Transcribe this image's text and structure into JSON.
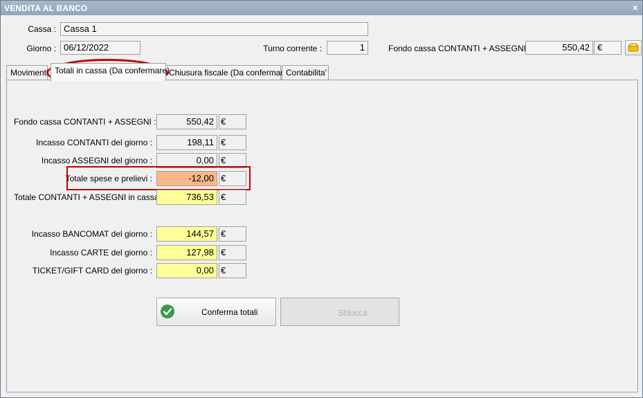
{
  "window": {
    "title": "VENDITA AL BANCO",
    "close_glyph": "×"
  },
  "header": {
    "cassa_label": "Cassa :",
    "cassa_value": "Cassa 1",
    "giorno_label": "Giorno :",
    "giorno_value": "06/12/2022",
    "turno_label": "Turno corrente :",
    "turno_value": "1",
    "fondo_label": "Fondo cassa CONTANTI + ASSEGNI :",
    "fondo_value": "550,42",
    "fondo_currency": "€"
  },
  "tabs": [
    {
      "label": "Movimenti"
    },
    {
      "label": "Totali in cassa (Da confermare)",
      "active": true
    },
    {
      "label": "Chiusura fiscale (Da confermare)"
    },
    {
      "label": "Contabilita'"
    }
  ],
  "totals": {
    "rows": [
      {
        "label": "Fondo cassa CONTANTI + ASSEGNI :",
        "value": "550,42",
        "currency": "€"
      },
      {
        "label": "Incasso CONTANTI del giorno :",
        "value": "198,11",
        "currency": "€"
      },
      {
        "label": "Incasso ASSEGNI del giorno :",
        "value": "0,00",
        "currency": "€"
      },
      {
        "label": "Totale spese e prelievi :",
        "value": "-12,00",
        "currency": "€"
      },
      {
        "label": "Totale CONTANTI + ASSEGNI in cassa :",
        "value": "736,53",
        "currency": "€"
      },
      {
        "label": "Incasso BANCOMAT del giorno :",
        "value": "144,57",
        "currency": "€"
      },
      {
        "label": "Incasso CARTE del giorno :",
        "value": "127,98",
        "currency": "€"
      },
      {
        "label": "TICKET/GIFT CARD del giorno :",
        "value": "0,00",
        "currency": "€"
      }
    ]
  },
  "buttons": {
    "confirm_label": "Conferma totali",
    "unlock_label": "Sblocca"
  },
  "colors": {
    "highlight_yellow": "#ffff99",
    "highlight_orange": "#f8b888",
    "annotation_red": "#c00000",
    "confirm_icon_green": "#3a9a4a"
  },
  "icons": {
    "drawer_button": "cash-drawer-icon",
    "confirm_button": "checkmark-icon"
  }
}
